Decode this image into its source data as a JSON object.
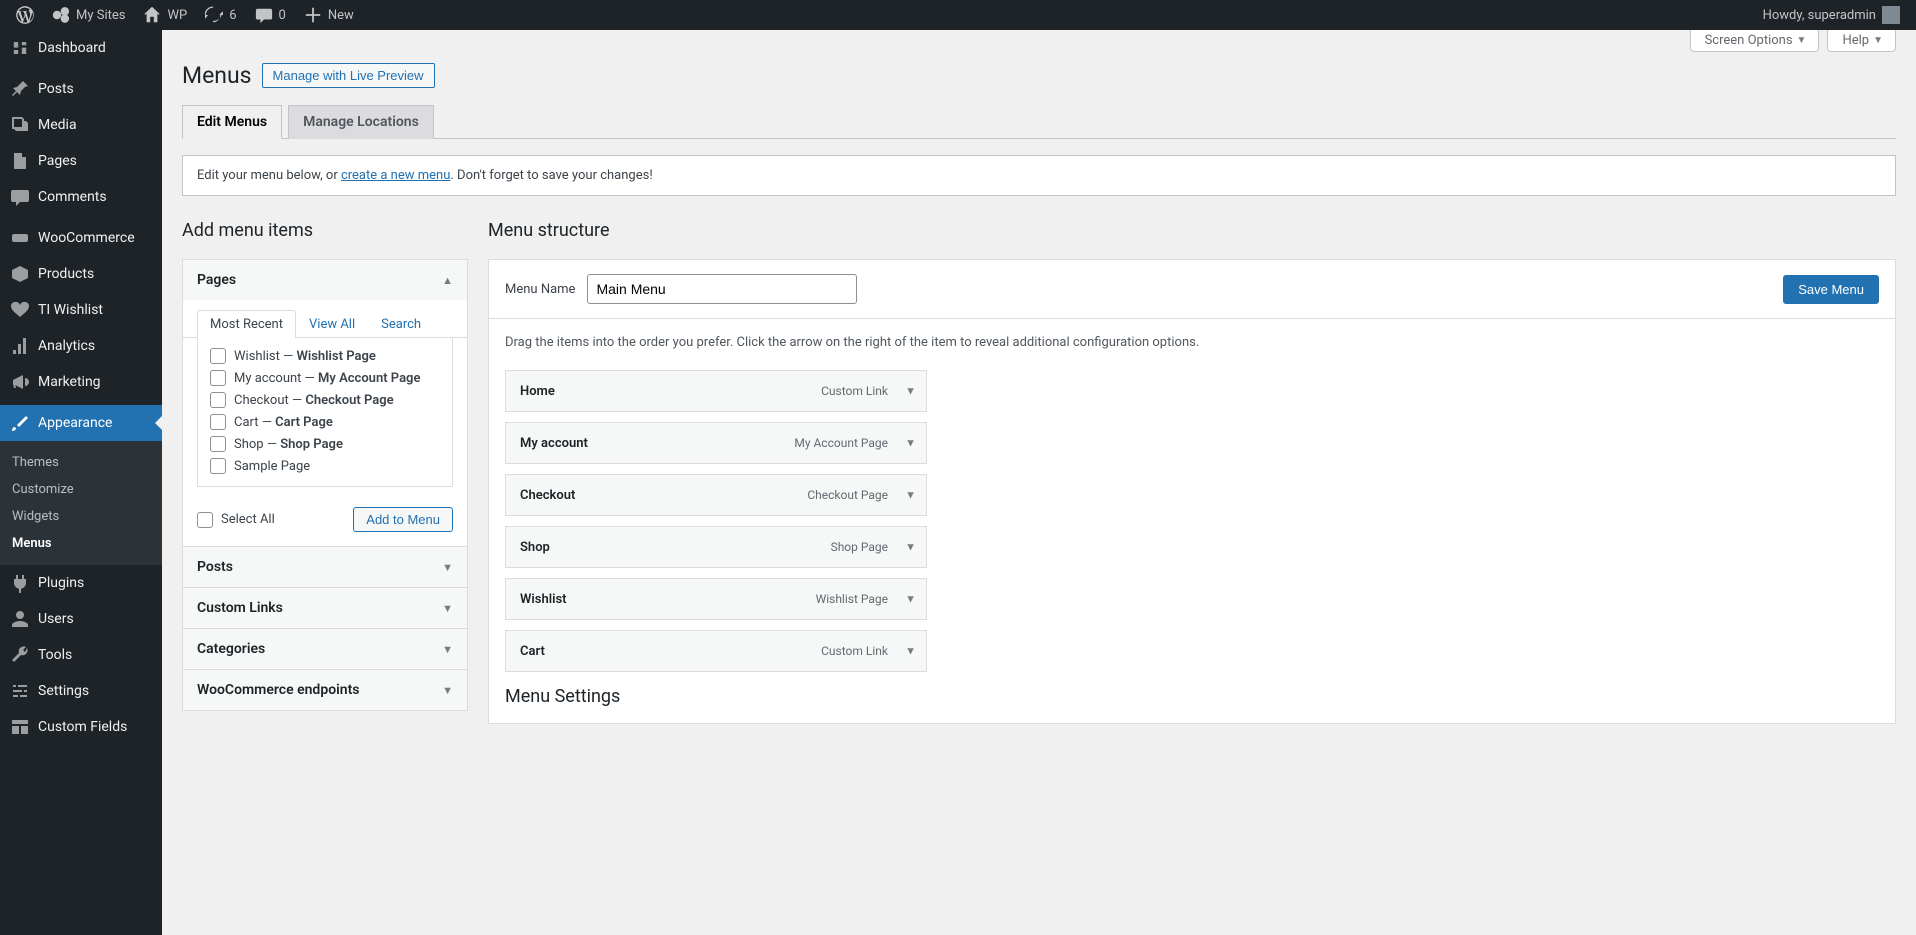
{
  "adminbar": {
    "my_sites": "My Sites",
    "site_name": "WP",
    "updates": "6",
    "comments": "0",
    "new": "New",
    "howdy": "Howdy, superadmin"
  },
  "sidebar": {
    "items": [
      {
        "label": "Dashboard"
      },
      {
        "label": "Posts"
      },
      {
        "label": "Media"
      },
      {
        "label": "Pages"
      },
      {
        "label": "Comments"
      },
      {
        "label": "WooCommerce"
      },
      {
        "label": "Products"
      },
      {
        "label": "TI Wishlist"
      },
      {
        "label": "Analytics"
      },
      {
        "label": "Marketing"
      },
      {
        "label": "Appearance"
      },
      {
        "label": "Plugins"
      },
      {
        "label": "Users"
      },
      {
        "label": "Tools"
      },
      {
        "label": "Settings"
      },
      {
        "label": "Custom Fields"
      }
    ],
    "submenu": [
      "Themes",
      "Customize",
      "Widgets",
      "Menus"
    ]
  },
  "screen_meta": {
    "screen_options": "Screen Options",
    "help": "Help"
  },
  "heading": {
    "title": "Menus",
    "action": "Manage with Live Preview"
  },
  "tabs": {
    "edit": "Edit Menus",
    "locations": "Manage Locations"
  },
  "notice": {
    "pre": "Edit your menu below, or ",
    "link": "create a new menu",
    "post": ". Don't forget to save your changes!"
  },
  "left_col_heading": "Add menu items",
  "right_col_heading": "Menu structure",
  "accordion": {
    "pages": {
      "title": "Pages",
      "tabs": {
        "recent": "Most Recent",
        "view_all": "View All",
        "search": "Search"
      },
      "items": [
        {
          "pre": "Wishlist — ",
          "bold": "Wishlist Page"
        },
        {
          "pre": "My account — ",
          "bold": "My Account Page"
        },
        {
          "pre": "Checkout — ",
          "bold": "Checkout Page"
        },
        {
          "pre": "Cart — ",
          "bold": "Cart Page"
        },
        {
          "pre": "Shop — ",
          "bold": "Shop Page"
        },
        {
          "pre": "Sample Page",
          "bold": ""
        }
      ],
      "select_all": "Select All",
      "add_btn": "Add to Menu"
    },
    "sections": [
      "Posts",
      "Custom Links",
      "Categories",
      "WooCommerce endpoints"
    ]
  },
  "menu_edit": {
    "name_label": "Menu Name",
    "name_value": "Main Menu",
    "save_btn": "Save Menu",
    "instructions": "Drag the items into the order you prefer. Click the arrow on the right of the item to reveal additional configuration options.",
    "items": [
      {
        "title": "Home",
        "type": "Custom Link"
      },
      {
        "title": "My account",
        "type": "My Account Page"
      },
      {
        "title": "Checkout",
        "type": "Checkout Page"
      },
      {
        "title": "Shop",
        "type": "Shop Page"
      },
      {
        "title": "Wishlist",
        "type": "Wishlist Page"
      },
      {
        "title": "Cart",
        "type": "Custom Link"
      }
    ],
    "settings_heading": "Menu Settings"
  }
}
